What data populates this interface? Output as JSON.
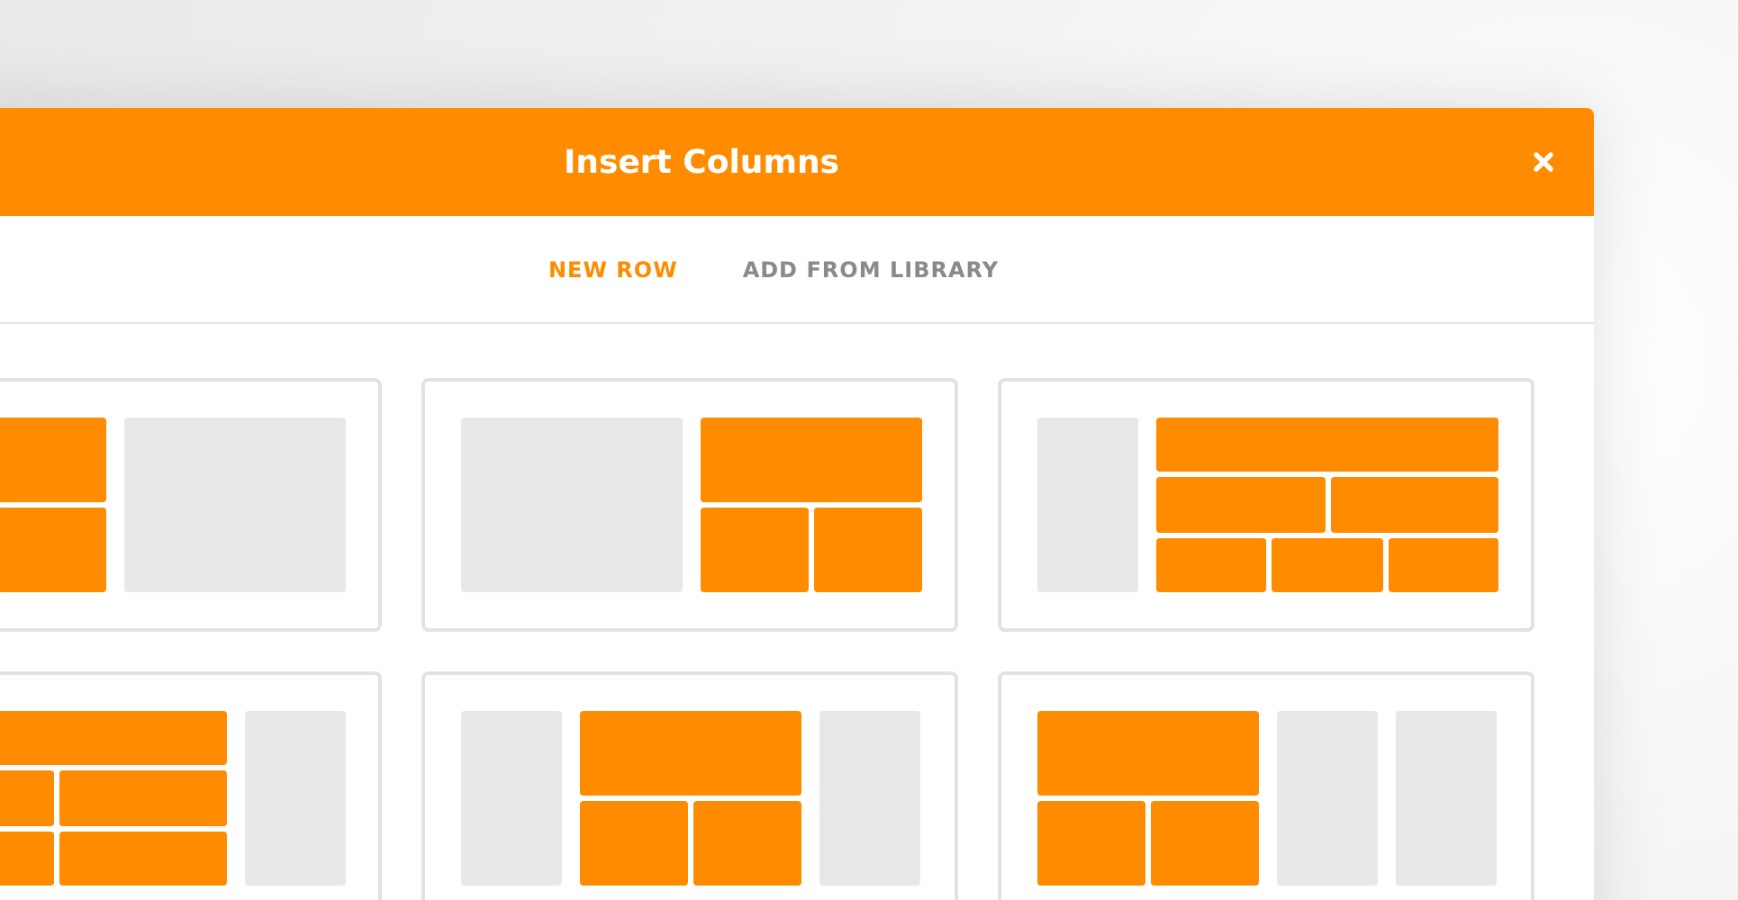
{
  "dialog": {
    "title": "Insert Columns"
  },
  "tabs": [
    {
      "label": "NEW ROW",
      "selected": true
    },
    {
      "label": "ADD FROM LIBRARY",
      "selected": false
    }
  ]
}
